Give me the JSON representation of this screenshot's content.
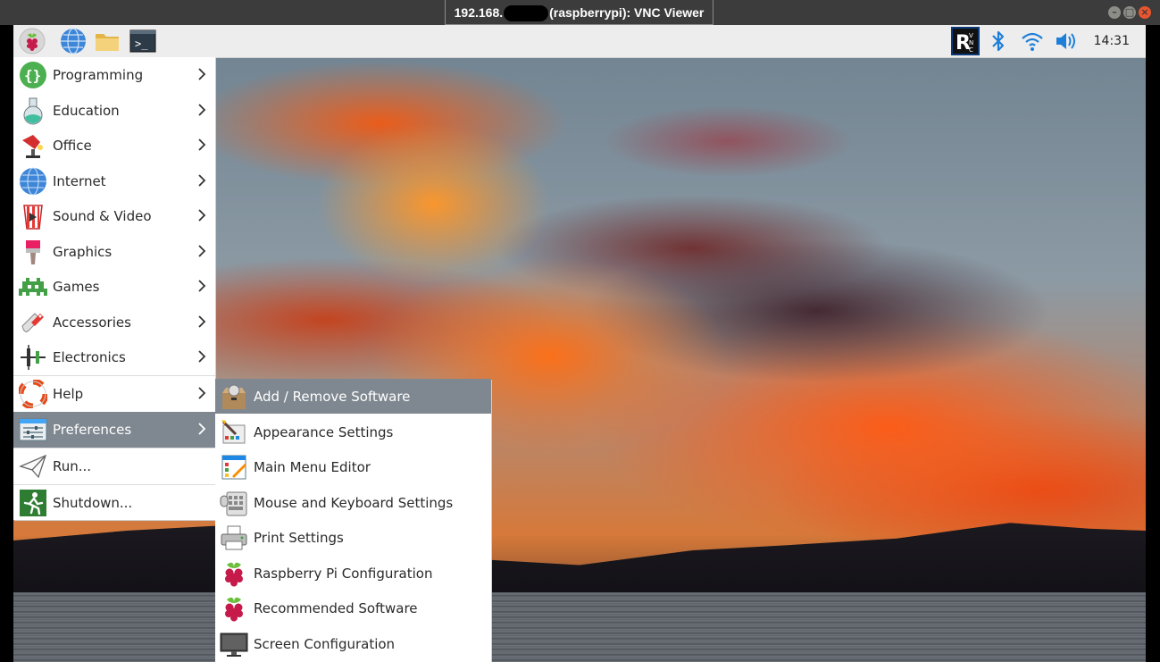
{
  "window": {
    "title_prefix": "192.168.",
    "title_suffix": "(raspberrypi): VNC Viewer",
    "buttons": [
      "–",
      "□",
      "×"
    ]
  },
  "taskbar": {
    "launchers": [
      "raspberry-pi-menu-icon",
      "web-browser-icon",
      "file-manager-icon",
      "terminal-icon"
    ],
    "tray": [
      "vnc-server-icon",
      "bluetooth-icon",
      "wifi-icon",
      "volume-icon"
    ],
    "clock": "14:31"
  },
  "menu": {
    "items": [
      {
        "label": "Programming",
        "icon": "programming-icon"
      },
      {
        "label": "Education",
        "icon": "education-icon"
      },
      {
        "label": "Office",
        "icon": "office-icon"
      },
      {
        "label": "Internet",
        "icon": "internet-icon"
      },
      {
        "label": "Sound & Video",
        "icon": "sound-video-icon"
      },
      {
        "label": "Graphics",
        "icon": "graphics-icon"
      },
      {
        "label": "Games",
        "icon": "games-icon"
      },
      {
        "label": "Accessories",
        "icon": "accessories-icon"
      },
      {
        "label": "Electronics",
        "icon": "electronics-icon"
      },
      {
        "label": "Help",
        "icon": "help-icon"
      },
      {
        "label": "Preferences",
        "icon": "preferences-icon",
        "selected": true
      },
      {
        "label": "Run...",
        "icon": "run-icon"
      },
      {
        "label": "Shutdown...",
        "icon": "shutdown-icon"
      }
    ]
  },
  "submenu": {
    "items": [
      {
        "label": "Add / Remove Software",
        "icon": "package-icon",
        "selected": true
      },
      {
        "label": "Appearance Settings",
        "icon": "appearance-icon"
      },
      {
        "label": "Main Menu Editor",
        "icon": "menu-editor-icon"
      },
      {
        "label": "Mouse and Keyboard Settings",
        "icon": "keyboard-mouse-icon"
      },
      {
        "label": "Print Settings",
        "icon": "printer-icon"
      },
      {
        "label": "Raspberry Pi Configuration",
        "icon": "raspberry-icon"
      },
      {
        "label": "Recommended Software",
        "icon": "raspberry-icon"
      },
      {
        "label": "Screen Configuration",
        "icon": "monitor-icon"
      }
    ]
  },
  "colors": {
    "menu_highlight": "#7f8890",
    "titlebar": "#3c3c3c",
    "taskbar": "#ededed"
  }
}
